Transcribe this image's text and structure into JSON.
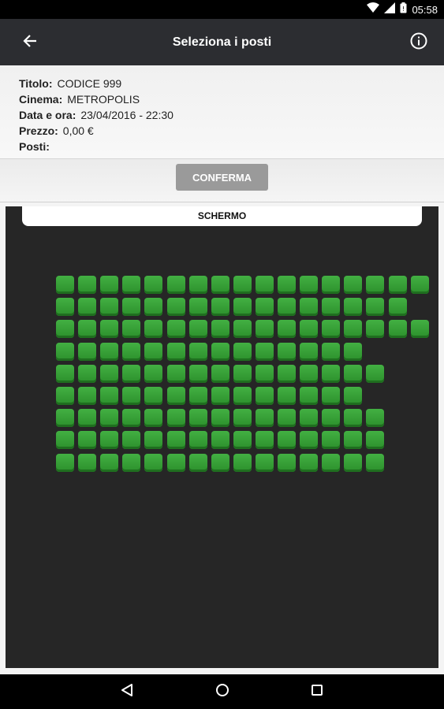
{
  "status_bar": {
    "time": "05:58",
    "icons": [
      "wifi-icon",
      "signal-icon",
      "battery-icon"
    ]
  },
  "app_bar": {
    "title": "Seleziona i posti",
    "back_icon": "back-arrow-icon",
    "info_icon": "info-icon"
  },
  "info": {
    "titolo_label": "Titolo:",
    "titolo_value": "CODICE 999",
    "cinema_label": "Cinema:",
    "cinema_value": "METROPOLIS",
    "data_label": "Data e ora:",
    "data_value": "23/04/2016 - 22:30",
    "prezzo_label": "Prezzo:",
    "prezzo_value": "0,00 €",
    "posti_label": "Posti:",
    "posti_value": ""
  },
  "confirm_button": "CONFERMA",
  "screen_label": "SCHERMO",
  "seating": {
    "rows": 9,
    "seat_color": "#3aa63a",
    "seats_per_row": [
      17,
      16,
      17,
      14,
      15,
      14,
      15,
      15,
      15
    ]
  },
  "nav_bar": {
    "icons": [
      "nav-back-icon",
      "nav-home-icon",
      "nav-recents-icon"
    ]
  },
  "colors": {
    "app_bar": "#2c2d31",
    "hall_background": "#262626",
    "button_disabled": "#9a9a9a",
    "seat_available": "#3aa63a"
  }
}
